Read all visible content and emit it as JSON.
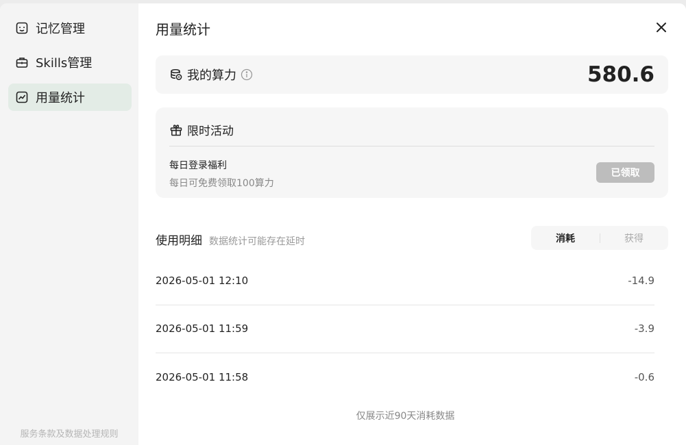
{
  "sidebar": {
    "items": [
      {
        "label": "记忆管理",
        "icon": "memory-icon"
      },
      {
        "label": "Skills管理",
        "icon": "toolbox-icon"
      },
      {
        "label": "用量统计",
        "icon": "chart-icon",
        "active": true
      }
    ],
    "footer": "服务条款及数据处理规则"
  },
  "main": {
    "title": "用量统计",
    "power": {
      "label": "我的算力",
      "value": "580.6"
    },
    "promo": {
      "title": "限时活动",
      "name": "每日登录福利",
      "desc": "每日可免费领取100算力",
      "button": "已领取"
    },
    "details": {
      "title": "使用明细",
      "note": "数据统计可能存在延时",
      "tabs": [
        "消耗",
        "获得"
      ],
      "rows": [
        {
          "time": "2026-05-01 12:10",
          "amount": "-14.9"
        },
        {
          "time": "2026-05-01 11:59",
          "amount": "-3.9"
        },
        {
          "time": "2026-05-01 11:58",
          "amount": "-0.6"
        }
      ],
      "footer": "仅展示近90天消耗数据"
    }
  },
  "colors": {
    "active_nav": "#e3ece6",
    "disabled_button": "#bdbdbd",
    "sidebar_bg": "#f4f4f4"
  }
}
